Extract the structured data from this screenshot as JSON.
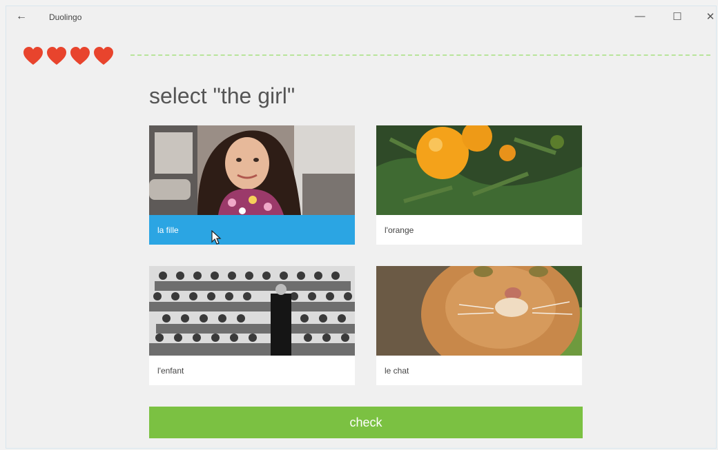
{
  "window": {
    "title": "Duolingo",
    "back_icon": "←",
    "minimize_icon": "—",
    "maximize_icon": "☐",
    "close_icon": "✕"
  },
  "lesson": {
    "hearts": 4,
    "prompt": "select \"the girl\"",
    "check_label": "check",
    "selected_index": 0,
    "options": [
      {
        "label": "la fille",
        "image": "girl-in-car-photo",
        "selected": true
      },
      {
        "label": "l'orange",
        "image": "oranges-on-tree-photo",
        "selected": false
      },
      {
        "label": "l'enfant",
        "image": "class-photo-children",
        "selected": false
      },
      {
        "label": "le chat",
        "image": "orange-cat-photo",
        "selected": false
      }
    ]
  },
  "colors": {
    "heart": "#e8442d",
    "selected": "#2ba5e3",
    "check_button": "#7bc142",
    "progress": "#b8e49a"
  }
}
